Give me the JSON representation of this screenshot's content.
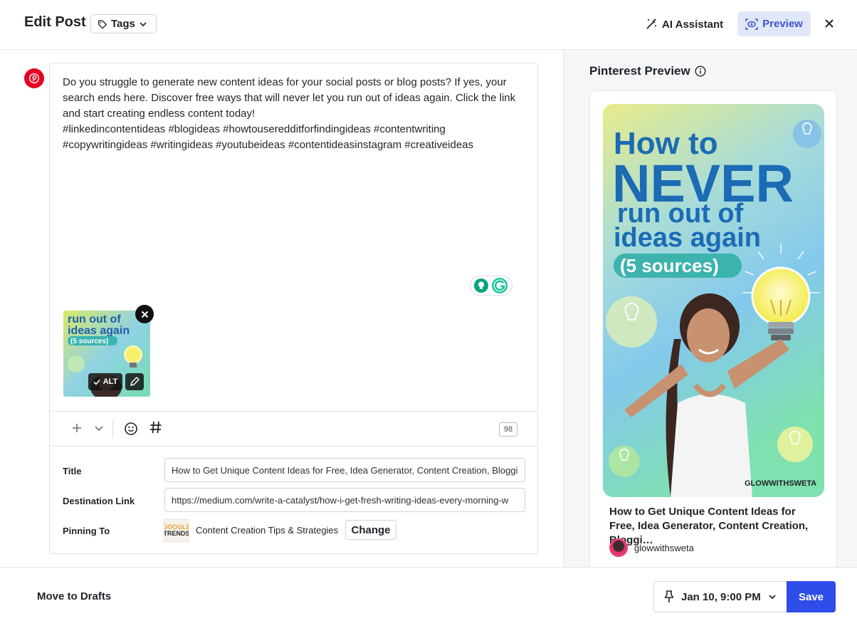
{
  "header": {
    "title": "Edit Post",
    "tags_label": "Tags",
    "ai_label": "AI Assistant",
    "preview_label": "Preview"
  },
  "post": {
    "text": "Do you struggle to generate new content ideas for your social posts or blog posts? If yes, your search ends here. Discover free ways that will never let you run out of ideas again. Click the link and start creating endless content today!\n#linkedincontentideas #blogideas #howtouseredditforfindingideas #contentwriting\n#copywritingideas #writingideas #youtubeideas #contentideasinstagram #creativeideas",
    "alt_label": "ALT",
    "thumb_text": [
      "run out of",
      "ideas again",
      "(5 sources)"
    ],
    "char_count": "98"
  },
  "fields": {
    "title_label": "Title",
    "title_value": "How to Get Unique Content Ideas for Free, Idea Generator, Content Creation, Blogging",
    "link_label": "Destination Link",
    "link_value": "https://medium.com/write-a-catalyst/how-i-get-fresh-writing-ideas-every-morning-w",
    "pinning_label": "Pinning To",
    "board_name": "Content Creation Tips & Strategies",
    "board_thumb": [
      "GOOGLE",
      "TRENDS"
    ],
    "change_label": "Change"
  },
  "preview": {
    "title": "Pinterest Preview",
    "image_text": {
      "line1": "How to",
      "line2": "NEVER",
      "line3": "run out of",
      "line4": "ideas again",
      "line5": "(5 sources)",
      "watermark": "GLOWWITHSWETA"
    },
    "headline": "How to Get Unique Content Ideas for Free, Idea Generator, Content Creation, Bloggi…",
    "username": "glowwithsweta"
  },
  "footer": {
    "drafts_label": "Move to Drafts",
    "schedule_label": "Jan 10, 9:00 PM",
    "save_label": "Save"
  },
  "colors": {
    "accent": "#2e4de8",
    "pinterest": "#e60023",
    "preview_bg": "#e1e7fb"
  }
}
